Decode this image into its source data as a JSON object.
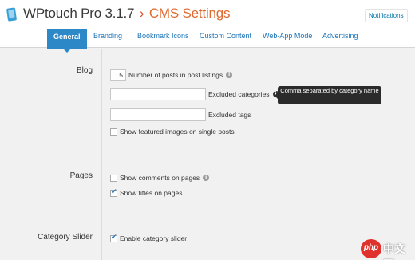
{
  "header": {
    "product": "WPtouch Pro 3.1.7",
    "separator": "›",
    "page_title": "CMS Settings",
    "notifications_label": "Notifications",
    "logo_color": "#3a9fd6"
  },
  "tabs": [
    {
      "label": "General",
      "active": true
    },
    {
      "label": "Branding",
      "active": false
    },
    {
      "label": "Bookmark Icons",
      "active": false
    },
    {
      "label": "Custom Content",
      "active": false
    },
    {
      "label": "Web-App Mode",
      "active": false
    },
    {
      "label": "Advertising",
      "active": false
    }
  ],
  "sections": {
    "blog": {
      "label": "Blog",
      "posts_count": "5",
      "posts_label": "Number of posts in post listings",
      "excluded_categories_label": "Excluded categories",
      "excluded_categories_value": "",
      "excluded_tags_label": "Excluded tags",
      "excluded_tags_value": "",
      "featured_images_label": "Show featured images on single posts",
      "featured_images_checked": false
    },
    "pages": {
      "label": "Pages",
      "comments_label": "Show comments on pages",
      "comments_checked": false,
      "titles_label": "Show titles on pages",
      "titles_checked": true
    },
    "category_slider": {
      "label": "Category Slider",
      "enable_label": "Enable category slider",
      "enable_checked": true
    }
  },
  "tooltip": {
    "text": "Comma separated by category name"
  },
  "watermark": {
    "badge": "php",
    "text": "中文网"
  },
  "icons": {
    "info": "info-icon",
    "logo": "wptouch-logo-icon"
  },
  "colors": {
    "accent": "#2d88c7",
    "title_orange": "#e0692f",
    "link_blue": "#1b73b7"
  }
}
